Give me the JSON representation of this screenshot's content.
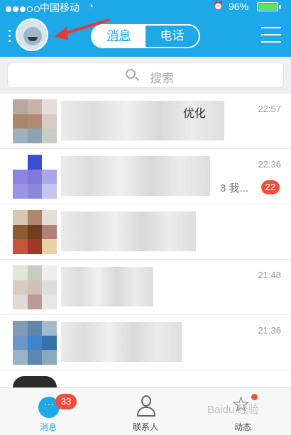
{
  "status_bar": {
    "carrier": "中国移动",
    "battery": "96%"
  },
  "header": {
    "tabs": [
      {
        "label": "消息",
        "active": true
      },
      {
        "label": "电话",
        "active": false
      }
    ]
  },
  "search": {
    "placeholder": "搜索"
  },
  "conversations": [
    {
      "time": "22:57",
      "title_fragment": "优化"
    },
    {
      "time": "22:36",
      "snippet": "3 我...",
      "badge": "22"
    },
    {
      "time": ""
    },
    {
      "time": "21:48"
    },
    {
      "time": "21:36"
    }
  ],
  "tabbar": {
    "items": [
      {
        "label": "消息",
        "badge": "33",
        "icon": "chat-bubble-icon"
      },
      {
        "label": "联系人",
        "icon": "person-icon"
      },
      {
        "label": "动态",
        "icon": "star-icon"
      }
    ]
  },
  "watermark": "Baidu 经验",
  "colors": {
    "accent": "#1fa8e8",
    "badge": "#f24e3c"
  }
}
